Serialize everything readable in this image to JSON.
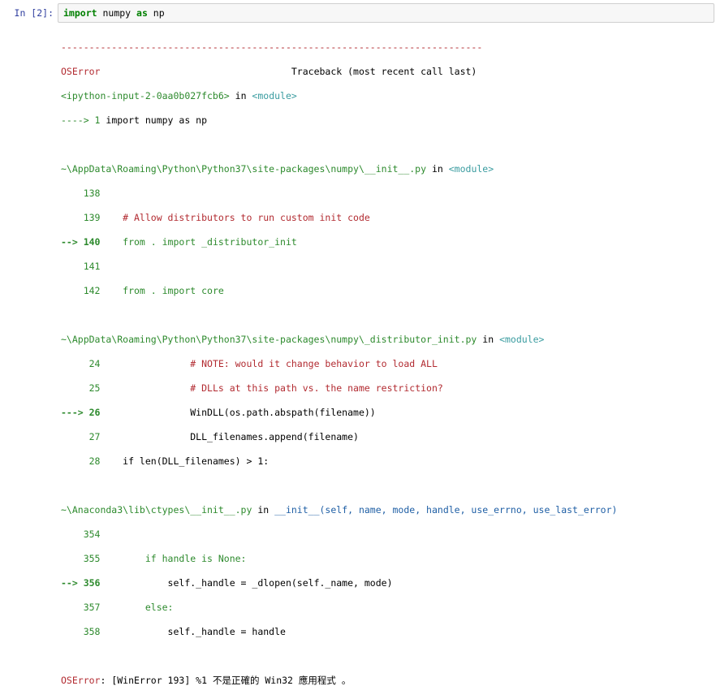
{
  "cell": {
    "prompt": "In [2]:",
    "input_kw1": "import",
    "input_mid": " numpy ",
    "input_kw2": "as",
    "input_end": " np"
  },
  "traceback": {
    "dashes": "---------------------------------------------------------------------------",
    "error_type": "OSError",
    "header_right": "Traceback (most recent call last)",
    "frame0": {
      "loc": "<ipython-input-2-0aa0b027fcb6>",
      "in": " in ",
      "fn": "<module>",
      "arrow": "----> 1 ",
      "code": "import numpy as np"
    },
    "frame1": {
      "path": "~\\AppData\\Roaming\\Python\\Python37\\site-packages\\numpy\\__init__.py",
      "in": " in ",
      "fn": "<module>",
      "lines": [
        {
          "num": "    138",
          "code": ""
        },
        {
          "num": "    139",
          "code": "    # Allow distributors to run custom init code"
        },
        {
          "num": "--> 140",
          "code": "    from . import _distributor_init"
        },
        {
          "num": "    141",
          "code": ""
        },
        {
          "num": "    142",
          "code": "    from . import core"
        }
      ]
    },
    "frame2": {
      "path": "~\\AppData\\Roaming\\Python\\Python37\\site-packages\\numpy\\_distributor_init.py",
      "in": " in ",
      "fn": "<module>",
      "lines": [
        {
          "num": "     24",
          "code": "                # NOTE: would it change behavior to load ALL"
        },
        {
          "num": "     25",
          "code": "                # DLLs at this path vs. the name restriction?"
        },
        {
          "num": "---> 26",
          "code": "                WinDLL(os.path.abspath(filename))"
        },
        {
          "num": "     27",
          "code": "                DLL_filenames.append(filename)"
        },
        {
          "num": "     28",
          "code": "    if len(DLL_filenames) > 1:"
        }
      ]
    },
    "frame3": {
      "path": "~\\Anaconda3\\lib\\ctypes\\__init__.py",
      "in": " in ",
      "fn": "__init__(self, name, mode, handle, use_errno, use_last_error)",
      "lines": [
        {
          "num": "    354",
          "code": ""
        },
        {
          "num": "    355",
          "code": "        if handle is None:"
        },
        {
          "num": "--> 356",
          "code": "            self._handle = _dlopen(self._name, mode)"
        },
        {
          "num": "    357",
          "code": "        else:"
        },
        {
          "num": "    358",
          "code": "            self._handle = handle"
        }
      ]
    },
    "final_type": "OSError",
    "final_msg": ": [WinError 193] %1 不是正確的 Win32 應用程式 。"
  }
}
